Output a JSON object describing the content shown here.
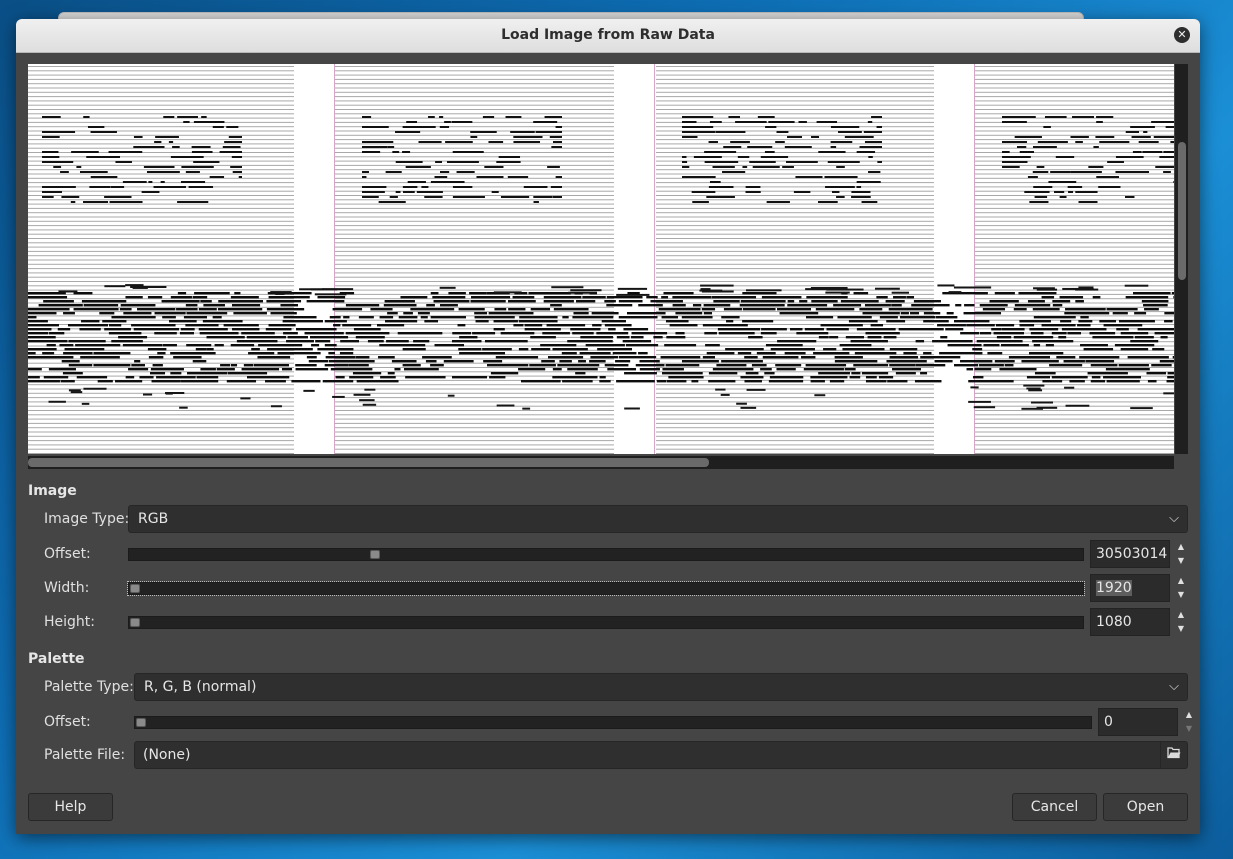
{
  "dialog": {
    "title": "Load Image from Raw Data",
    "close_icon": "close-icon"
  },
  "preview": {
    "visible_text": "FLAG"
  },
  "image_section": {
    "title": "Image",
    "image_type_label": "Image Type:",
    "image_type_value": "RGB",
    "offset_label": "Offset:",
    "offset_value": "30503014",
    "width_label": "Width:",
    "width_value": "1920",
    "height_label": "Height:",
    "height_value": "1080"
  },
  "palette_section": {
    "title": "Palette",
    "palette_type_label": "Palette Type:",
    "palette_type_value": "R, G, B (normal)",
    "offset_label": "Offset:",
    "offset_value": "0",
    "palette_file_label": "Palette File:",
    "palette_file_value": "(None)"
  },
  "buttons": {
    "help": "Help",
    "cancel": "Cancel",
    "open": "Open"
  },
  "colors": {
    "dialog_bg": "#454545",
    "titlebar_bg": "#e8e8e8",
    "field_bg": "#2f2f2f",
    "desktop_bg": "#0e6db3"
  }
}
